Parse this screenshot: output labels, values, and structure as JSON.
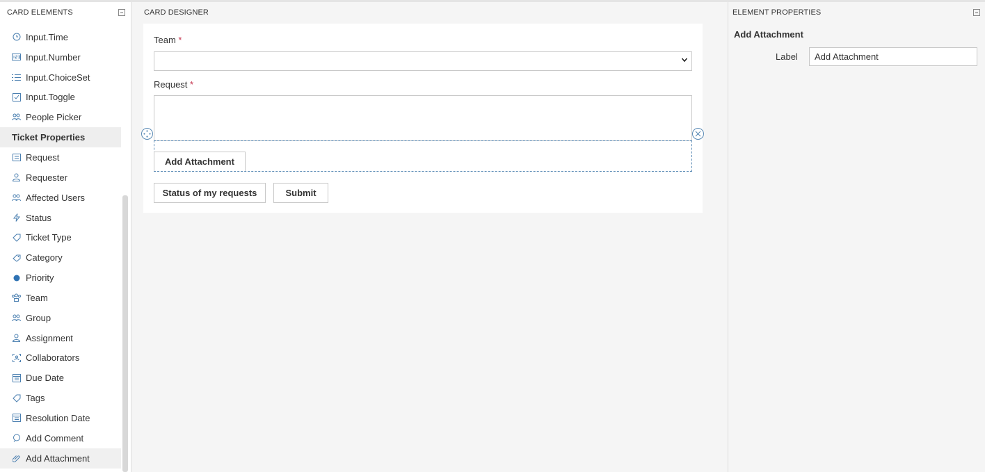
{
  "left_pane": {
    "title": "CARD ELEMENTS",
    "items": [
      {
        "label": "Input.Time",
        "icon": "clock-icon"
      },
      {
        "label": "Input.Number",
        "icon": "number-icon"
      },
      {
        "label": "Input.ChoiceSet",
        "icon": "list-icon"
      },
      {
        "label": "Input.Toggle",
        "icon": "checkbox-icon"
      },
      {
        "label": "People Picker",
        "icon": "people-icon"
      },
      {
        "label": "Ticket Properties",
        "icon": ""
      },
      {
        "label": "Request",
        "icon": "request-icon"
      },
      {
        "label": "Requester",
        "icon": "person-icon"
      },
      {
        "label": "Affected Users",
        "icon": "people-icon"
      },
      {
        "label": "Status",
        "icon": "status-icon"
      },
      {
        "label": "Ticket Type",
        "icon": "tag-icon"
      },
      {
        "label": "Category",
        "icon": "category-icon"
      },
      {
        "label": "Priority",
        "icon": "dot-icon"
      },
      {
        "label": "Team",
        "icon": "team-icon"
      },
      {
        "label": "Group",
        "icon": "group-icon"
      },
      {
        "label": "Assignment",
        "icon": "person-icon"
      },
      {
        "label": "Collaborators",
        "icon": "collaborators-icon"
      },
      {
        "label": "Due Date",
        "icon": "calendar-icon"
      },
      {
        "label": "Tags",
        "icon": "tag-icon"
      },
      {
        "label": "Resolution Date",
        "icon": "calendar-icon"
      },
      {
        "label": "Add Comment",
        "icon": "comment-icon"
      },
      {
        "label": "Add Attachment",
        "icon": "paperclip-icon"
      }
    ]
  },
  "designer": {
    "title": "CARD DESIGNER",
    "team_label": "Team",
    "request_label": "Request",
    "required_mark": "*",
    "attachment_button": "Add Attachment",
    "status_button": "Status of my requests",
    "submit_button": "Submit"
  },
  "properties": {
    "title": "ELEMENT PROPERTIES",
    "element_name": "Add Attachment",
    "label_caption": "Label",
    "label_value": "Add Attachment"
  },
  "colors": {
    "accent": "#4a7fb0",
    "selection": "#5a8ab5",
    "required": "#c4314b"
  }
}
